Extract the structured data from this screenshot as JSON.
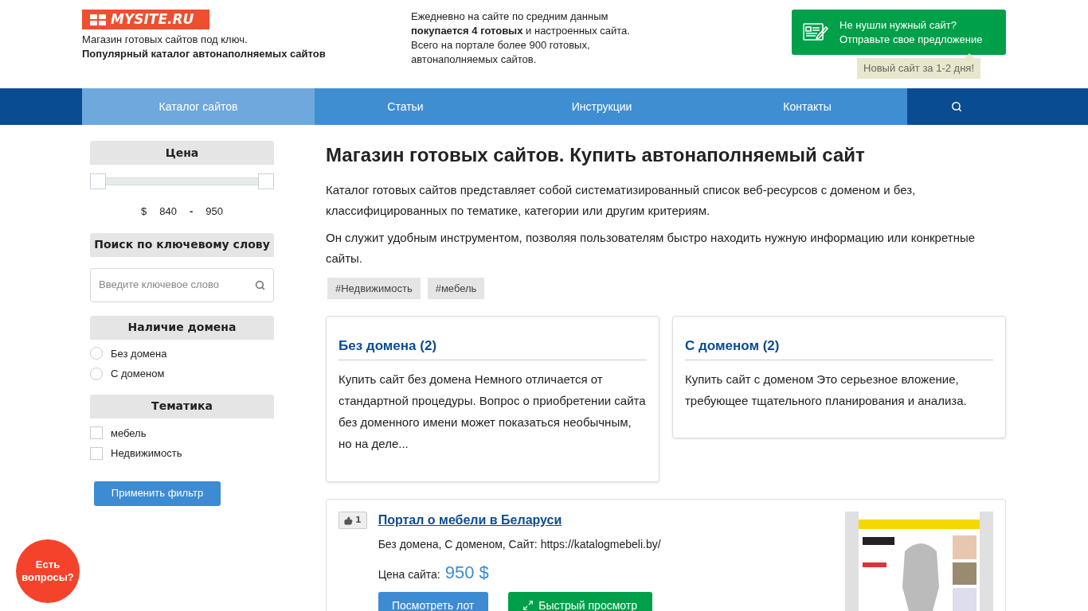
{
  "header": {
    "logo": "MYSITE.RU",
    "tagline": "Магазин готовых сайтов под ключ.",
    "tagline_bold": "Популярный каталог автонаполняемых сайтов",
    "info": "Ежедневно на сайте по средним данным **покупается 4 готовых** и настроенных сайта. Всего на портале более 900 готовых, автонаполняемых сайтов.",
    "cta": {
      "line1": "Не нушли нужный сайт?",
      "line2": "Отправьте свое предложение"
    },
    "cta_note": "Новый сайт за 1-2 дня!"
  },
  "nav": [
    {
      "label": "Каталог сайтов",
      "selected": true
    },
    {
      "label": "Статьи",
      "selected": false
    },
    {
      "label": "Инструкции",
      "selected": false
    },
    {
      "label": "Контакты",
      "selected": false
    }
  ],
  "sidebar": {
    "price": {
      "title": "Цена",
      "thumbs": [
        {
          "level": 0
        },
        {
          "level": 1
        }
      ],
      "currency": "$",
      "min": "840",
      "dash": "-",
      "max": "950"
    },
    "search": {
      "title": "Поиск по ключевому слову",
      "placeholder": "Введите ключевое слово"
    },
    "domain": {
      "title": "Наличие домена",
      "options": [
        {
          "label": "Без домена",
          "selected": false
        },
        {
          "label": "С доменом",
          "selected": false
        }
      ]
    },
    "topics": {
      "title": "Тематика",
      "options": [
        {
          "label": "мебель",
          "checked": false
        },
        {
          "label": "Недвижимость",
          "checked": false
        }
      ]
    },
    "apply": "Применить фильтр"
  },
  "main": {
    "title": "Магазин готовых сайтов. Купить автонаполняемый сайт",
    "paragraphs": [
      "Каталог готовых сайтов представляет собой систематизированный список веб-ресурсов с доменом и без, классифицированных по тематике, категории или другим критериям.",
      "Он служит удобным инструментом, позволяя пользователям быстро находить нужную информацию или конкретные сайты."
    ],
    "tags": [
      "#Недвижимость",
      "#мебель"
    ],
    "cards": [
      {
        "title": "Без домена (2)",
        "text": "Купить сайт без домена Немного отличается от стандартной процедуры. Вопрос о приобретении сайта без доменного имени может показаться необычным, но на деле..."
      },
      {
        "title": "С доменом (2)",
        "text": "Купить сайт с доменом Это серьезное вложение, требующее тщательного планирования и анализа."
      }
    ],
    "listing": {
      "likes": "1",
      "title": "Портал о мебели в Беларуси",
      "meta": "Без домена, С доменом, Сайт: https://katalogmebeli.by/",
      "price_label": "Цена сайта:",
      "price": "950 $",
      "view": "Посмотреть лот",
      "quick": "Быстрый просмотр"
    }
  },
  "chat": {
    "line1": "Есть",
    "line2": "вопросы?"
  }
}
